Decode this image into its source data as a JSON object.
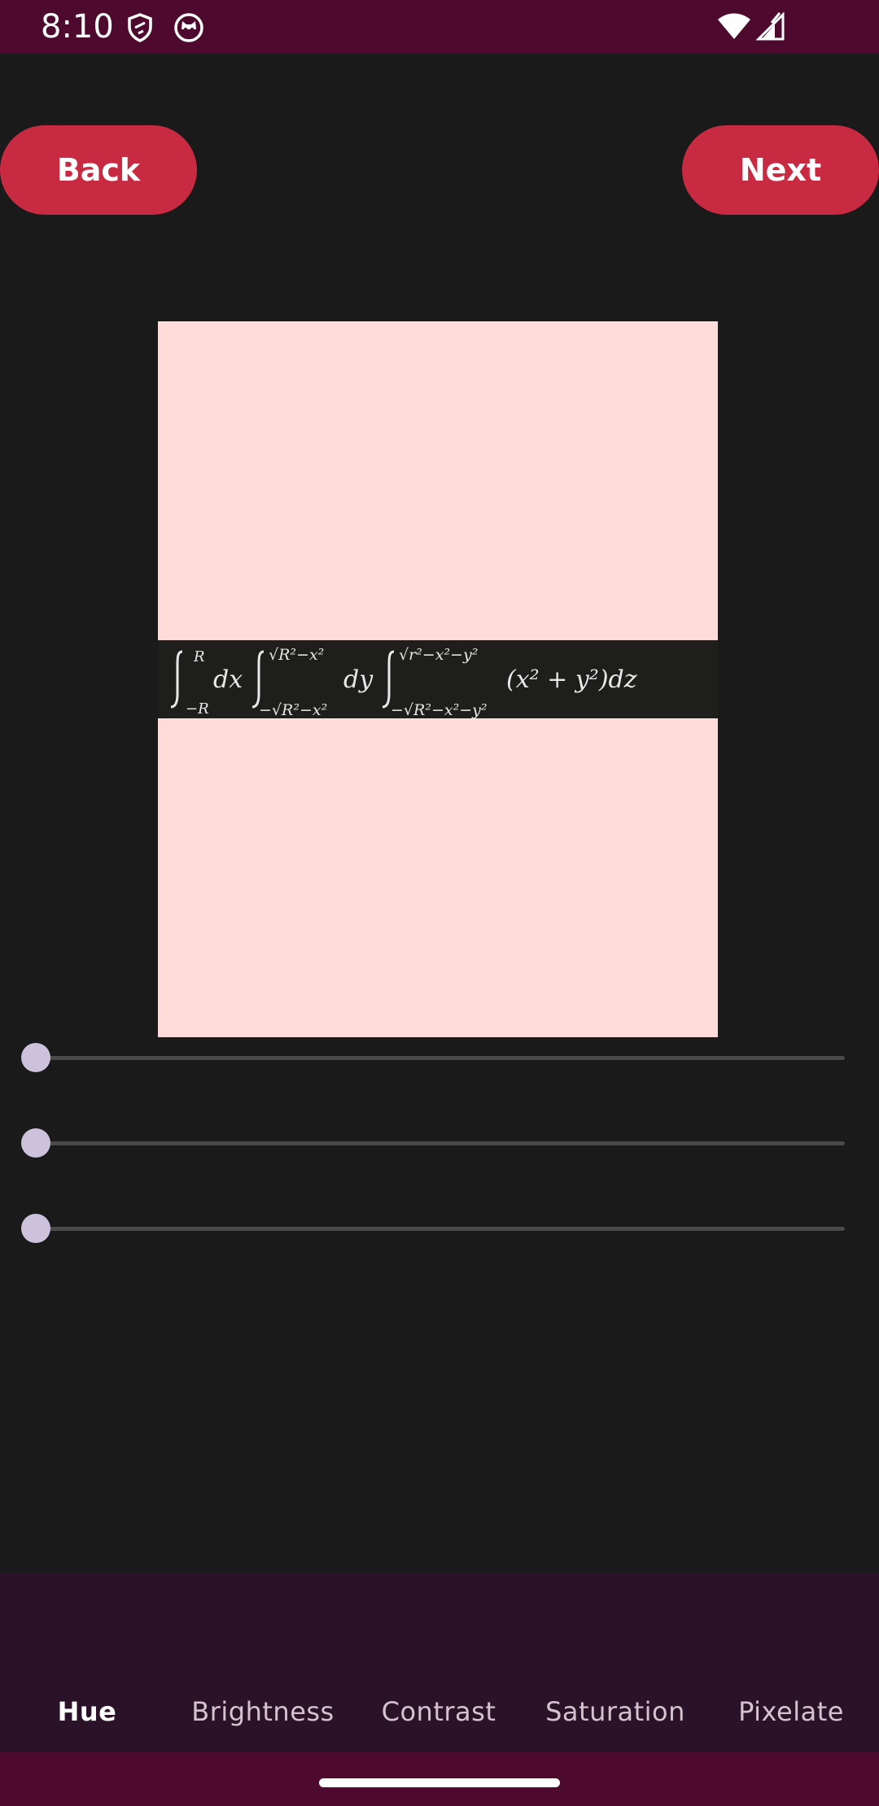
{
  "status": {
    "time": "8:10",
    "icons": [
      "shield-icon",
      "cat-face-icon",
      "wifi-icon",
      "signal-icon"
    ]
  },
  "toolbar": {
    "back_label": "Back",
    "next_label": "Next"
  },
  "preview": {
    "formula": "∫_{-R}^{R} dx ∫_{-√(R²−x²)}^{√(R²−x²)} dy ∫_{-√(R²−x²−y²)}^{√(r²−x²−y²)} (x² + y²) dz"
  },
  "sliders": [
    {
      "name": "slider-1",
      "value": 0
    },
    {
      "name": "slider-2",
      "value": 0
    },
    {
      "name": "slider-3",
      "value": 0
    }
  ],
  "tabs": [
    {
      "label": "Hue",
      "active": true
    },
    {
      "label": "Brightness",
      "active": false
    },
    {
      "label": "Contrast",
      "active": false
    },
    {
      "label": "Saturation",
      "active": false
    },
    {
      "label": "Pixelate",
      "active": false
    }
  ],
  "colors": {
    "accent": "#c82a42",
    "status_bar": "#4d0a2e",
    "background": "#1a1a1a",
    "preview_bg": "#ffdcda",
    "tab_bar": "#2a1228",
    "slider_thumb": "#cdc2dc"
  }
}
